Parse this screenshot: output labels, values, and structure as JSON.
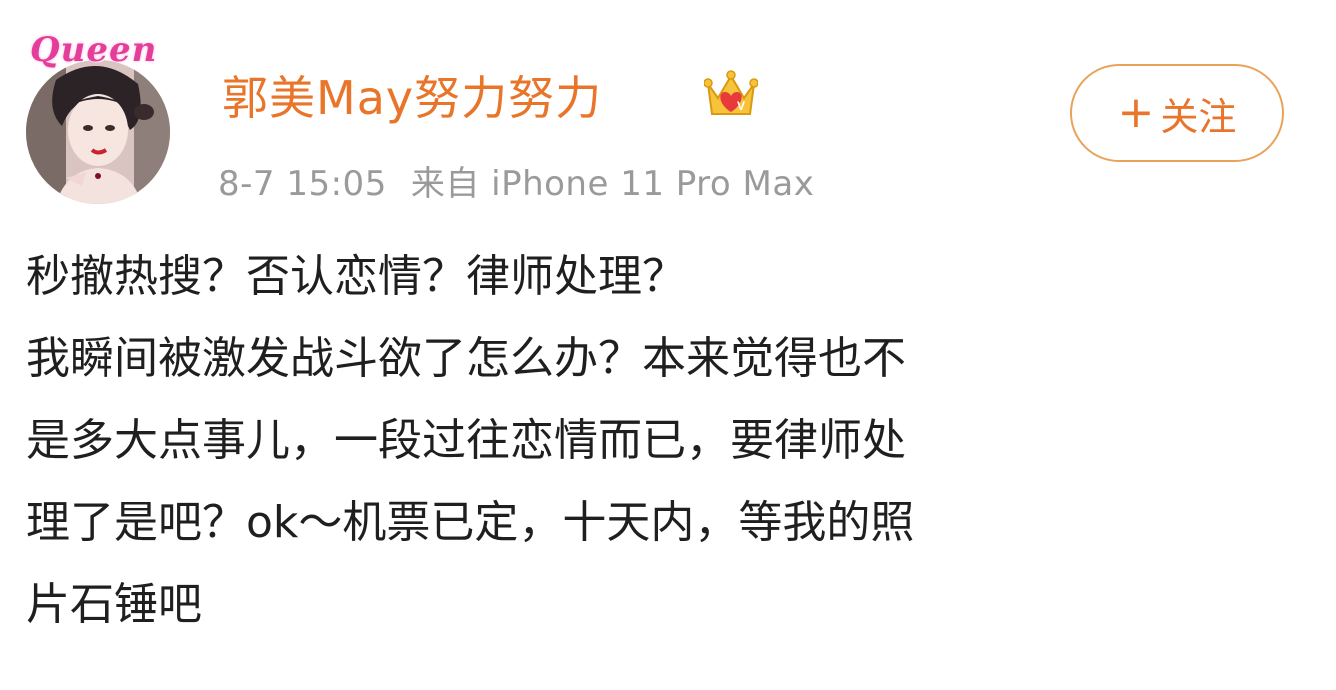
{
  "post": {
    "avatar_frame_text": "Queen",
    "username": "郭美May努力努力",
    "badge_icon": "crown-heart-icon",
    "timestamp": "8-7 15:05",
    "source": "来自 iPhone 11 Pro Max",
    "follow_label": "关注",
    "follow_plus": "+",
    "content_line_1": "秒撤热搜？否认恋情？律师处理？",
    "content_line_2": "我瞬间被激发战斗欲了怎么办？本来觉得也不",
    "content_line_3": "是多大点事儿，一段过往恋情而已，要律师处",
    "content_line_4": "理了是吧？ok～机票已定，十天内，等我的照",
    "content_line_5": "片石锤吧"
  },
  "colors": {
    "username": "#e8752a",
    "meta": "#9a9a9a",
    "follow_border": "#e8a35a",
    "text": "#1f1f1f"
  }
}
